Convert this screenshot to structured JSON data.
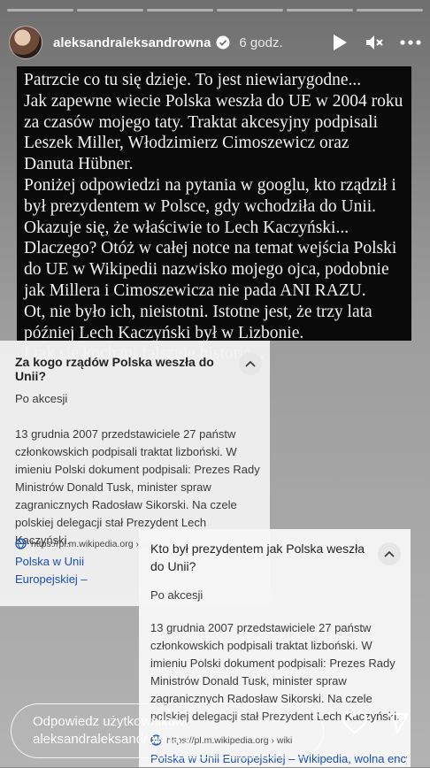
{
  "header": {
    "username": "aleksandraleksandrowna",
    "time": "6 godz."
  },
  "post_text": "Patrzcie co tu się dzieje. To jest niewiarygodne...\nJak zapewne wiecie Polska weszła do UE w 2004 roku\nza czasów mojego taty. Traktat akcesyjny podpisali\nLeszek Miller, Włodzimierz Cimoszewicz oraz\nDanuta Hübner.\nPoniżej odpowiedzi na pytania w googlu, kto rządził i\nbył prezydentem w Polsce, gdy wchodziła do Unii.\nOkazuje się, że właściwie to Lech Kaczyński...\nDlaczego? Otóż w całej notce na temat wejścia Polski\ndo UE w Wikipedii nazwisko mojego ojca, podobnie\njak Millera i Cimoszewicza nie pada ANI RAZU.\nOt, nie było ich, nieistotni. Istotne jest, że trzy lata\npóźniej Lech Kaczyński był w Lizbonie.\nI tak się kochani fałszuje historię...",
  "card1": {
    "question": "Za kogo rządów Polska weszła do Unii?",
    "short_answer": "Po akcesji",
    "answer": "13 grudnia 2007 przedstawiciele 27 państw członkowskich podpisali traktat lizboński. W imieniu Polski dokument podpisali: Prezes Rady Ministrów Donald Tusk, minister spraw zagranicznych Radosław Sikorski. Na czele polskiej delegacji stał Prezydent Lech Kaczyński.",
    "source_url": "https://pl.m.wikipedia.org › wiki",
    "link": "Polska w Unii Europejskiej – Wikipedia, wolna encyklopedia"
  },
  "card2": {
    "question": "Kto był prezydentem jak Polska weszła do Unii?",
    "short_answer": "Po akcesji",
    "answer": "13 grudnia 2007 przedstawiciele 27 państw członkowskich podpisali traktat lizboński. W imieniu Polski dokument podpisali: Prezes Rady Ministrów Donald Tusk, minister spraw zagranicznych Radosław Sikorski. Na czele polskiej delegacji stał Prezydent Lech Kaczyński.",
    "source_url": "https://pl.m.wikipedia.org › wiki",
    "link": "Polska w Unii Europejskiej – Wikipedia, wolna encyklopedia"
  },
  "reply": {
    "placeholder": "Odpowiedz użytkownikowi aleksandraleksandrowna..."
  },
  "colors": {
    "text_block_bg": "#0a0a0a",
    "link": "#1a4fb4"
  }
}
